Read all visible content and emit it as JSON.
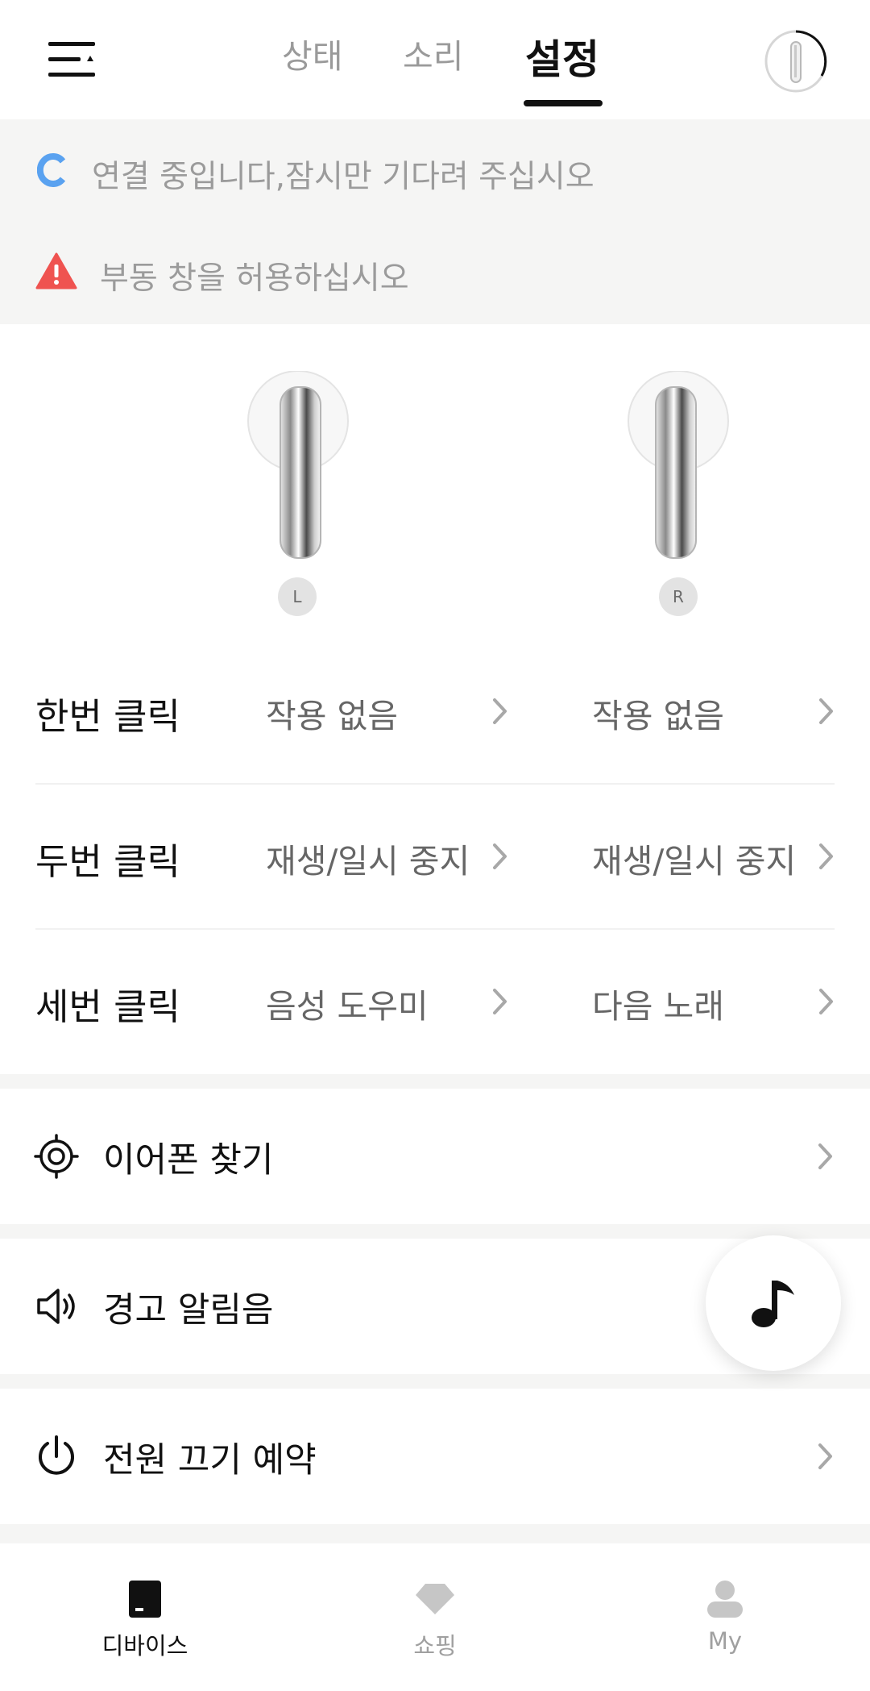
{
  "header": {
    "tabs": [
      {
        "label": "상태",
        "active": false
      },
      {
        "label": "소리",
        "active": false
      },
      {
        "label": "설정",
        "active": true
      }
    ]
  },
  "notices": [
    {
      "icon": "loading-c-icon",
      "text": "연결 중입니다,잠시만 기다려 주십시오"
    },
    {
      "icon": "warning-icon",
      "text": "부동 창을 허용하십시오"
    }
  ],
  "earbuds": {
    "left_badge": "L",
    "right_badge": "R"
  },
  "gestures": [
    {
      "label": "한번 클릭",
      "left": "작용 없음",
      "right": "작용 없음"
    },
    {
      "label": "두번 클릭",
      "left": "재생/일시 중지",
      "right": "재생/일시 중지"
    },
    {
      "label": "세번 클릭",
      "left": "음성 도우미",
      "right": "다음 노래"
    }
  ],
  "menu": [
    {
      "icon": "crosshair-icon",
      "label": "이어폰 찾기"
    },
    {
      "icon": "speaker-icon",
      "label": "경고 알림음"
    },
    {
      "icon": "power-icon",
      "label": "전원 끄기 예약"
    }
  ],
  "bottom_nav": [
    {
      "icon": "device-icon",
      "label": "디바이스",
      "active": true
    },
    {
      "icon": "diamond-icon",
      "label": "쇼핑",
      "active": false
    },
    {
      "icon": "person-icon",
      "label": "My",
      "active": false
    }
  ],
  "colors": {
    "accent": "#111111",
    "loading": "#5aa2f0",
    "warning": "#ef5350",
    "muted_text": "#9b9b9b",
    "band": "#f5f5f4"
  }
}
